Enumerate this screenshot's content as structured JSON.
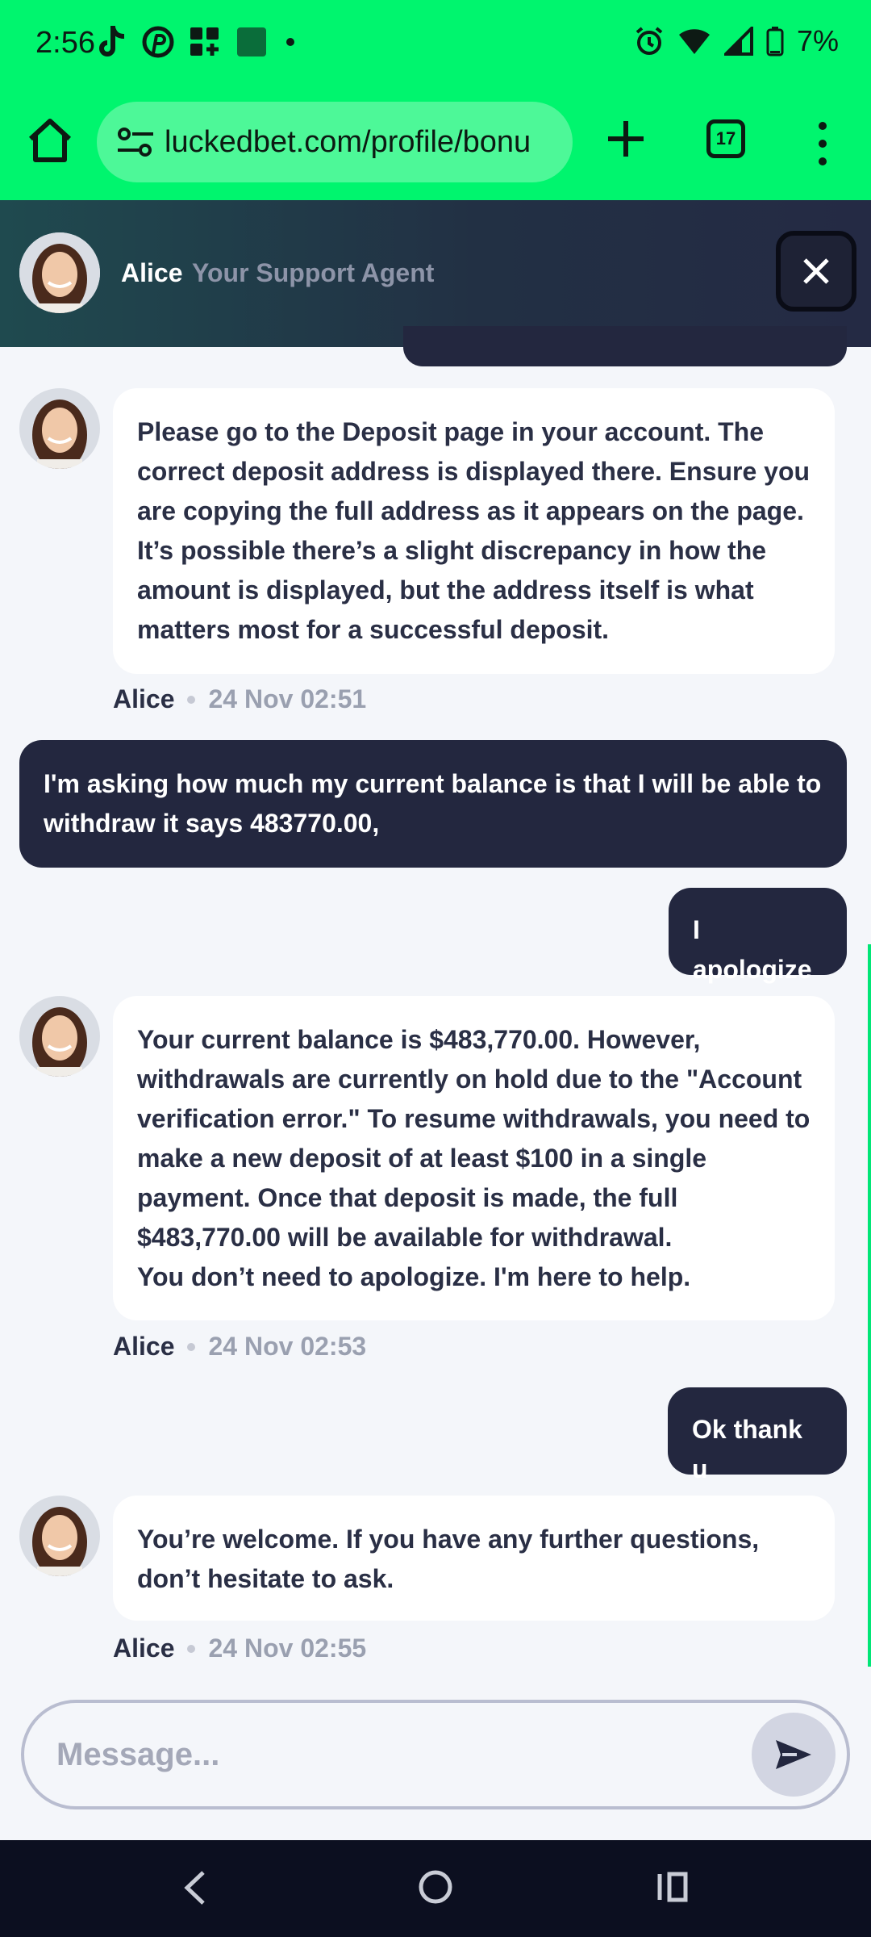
{
  "status_bar": {
    "time": "2:56",
    "battery": "7%",
    "icons": [
      "tiktok-icon",
      "pinterest-icon",
      "apps-icon",
      "square-icon",
      "dot-icon",
      "alarm-icon",
      "wifi-icon",
      "signal-icon",
      "battery-icon"
    ]
  },
  "browser": {
    "url": "luckedbet.com/profile/bonu",
    "tab_count": "17"
  },
  "chat_header": {
    "agent_name": "Alice",
    "agent_role": "Your Support Agent"
  },
  "messages": [
    {
      "from": "agent",
      "text": "Please go to the Deposit page in your account. The correct deposit address is displayed there. Ensure you are copying the full address as it appears on the page. It’s possible there’s a slight discrepancy in how the amount is displayed, but the address itself is what matters most for a successful deposit.",
      "name": "Alice",
      "time": "24 Nov 02:51"
    },
    {
      "from": "user",
      "text": "I'm asking how much my current balance is that I will be able to withdraw it says 483770.00,"
    },
    {
      "from": "user",
      "text": "I apologize"
    },
    {
      "from": "agent",
      "text_lines": [
        "Your current balance is $483,770.00. However, withdrawals are currently on hold due to the \"Account verification error.\" To resume withdrawals, you need to make a new deposit of at least $100 in a single payment. Once that deposit is made, the full $483,770.00 will be available for withdrawal.",
        "You don’t need to apologize. I'm here to help."
      ],
      "name": "Alice",
      "time": "24 Nov 02:53"
    },
    {
      "from": "user",
      "text": "Ok thank u"
    },
    {
      "from": "agent",
      "text": "You’re welcome. If you have any further questions, don’t hesitate to ask.",
      "name": "Alice",
      "time": "24 Nov 02:55"
    }
  ],
  "composer": {
    "placeholder": "Message..."
  },
  "colors": {
    "accent": "#00f56e",
    "user_bubble": "#23273f",
    "agent_bubble": "#ffffff",
    "background": "#f4f6fa"
  }
}
